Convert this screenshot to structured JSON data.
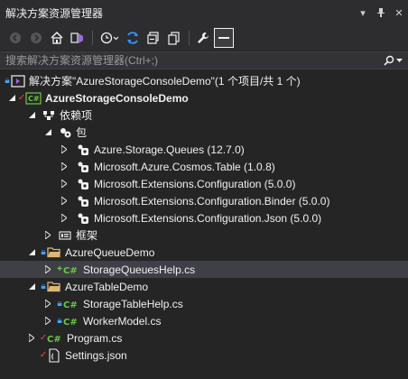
{
  "panel": {
    "title": "解决方案资源管理器",
    "controls": {
      "dropdown": "▾",
      "pin": "⊥",
      "close": "✕"
    }
  },
  "toolbar": {
    "items": [
      "back",
      "forward",
      "home",
      "vs-switch",
      "history",
      "sync",
      "collapse",
      "show-all",
      "properties",
      "preview"
    ]
  },
  "search": {
    "placeholder": "搜索解决方案资源管理器(Ctrl+;)"
  },
  "tree": {
    "solution": "解决方案\"AzureStorageConsoleDemo\"(1 个项目/共 1 个)",
    "project": "AzureStorageConsoleDemo",
    "dependencies": "依赖项",
    "packages": "包",
    "package_items": [
      "Azure.Storage.Queues (12.7.0)",
      "Microsoft.Azure.Cosmos.Table (1.0.8)",
      "Microsoft.Extensions.Configuration (5.0.0)",
      "Microsoft.Extensions.Configuration.Binder (5.0.0)",
      "Microsoft.Extensions.Configuration.Json (5.0.0)"
    ],
    "frameworks": "框架",
    "folder_queue": "AzureQueueDemo",
    "file_queue_help": "StorageQueuesHelp.cs",
    "folder_table": "AzureTableDemo",
    "file_table_help": "StorageTableHelp.cs",
    "file_worker_model": "WorkerModel.cs",
    "file_program": "Program.cs",
    "file_settings": "Settings.json",
    "cs_badge": "C#"
  },
  "colors": {
    "background": "#252526",
    "toolbar": "#2d2d30",
    "selection": "#3f3f46",
    "folder": "#dcb67a",
    "source_control_lock": "#4aa3f0",
    "source_control_check": "#e84a4a",
    "source_control_add": "#6fd06f"
  }
}
